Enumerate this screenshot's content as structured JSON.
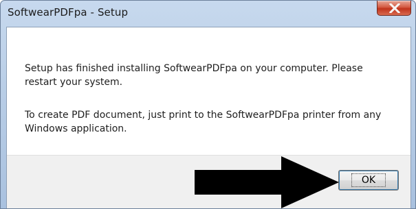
{
  "window": {
    "title": "SoftwearPDFpa - Setup"
  },
  "message": {
    "line1": "Setup has finished installing SoftwearPDFpa on your computer. Please restart your system.",
    "line2": "To create PDF document, just print to the SoftwearPDFpa printer from any Windows application."
  },
  "buttons": {
    "ok_label": "OK"
  },
  "annotation": {
    "arrow_color": "#000000",
    "arrow_direction": "right"
  },
  "colors": {
    "close_button": "#c7422a",
    "focus_ring": "#3c7fb1"
  },
  "icons": {
    "close": "close-icon",
    "annotation": "arrow-right-icon"
  }
}
